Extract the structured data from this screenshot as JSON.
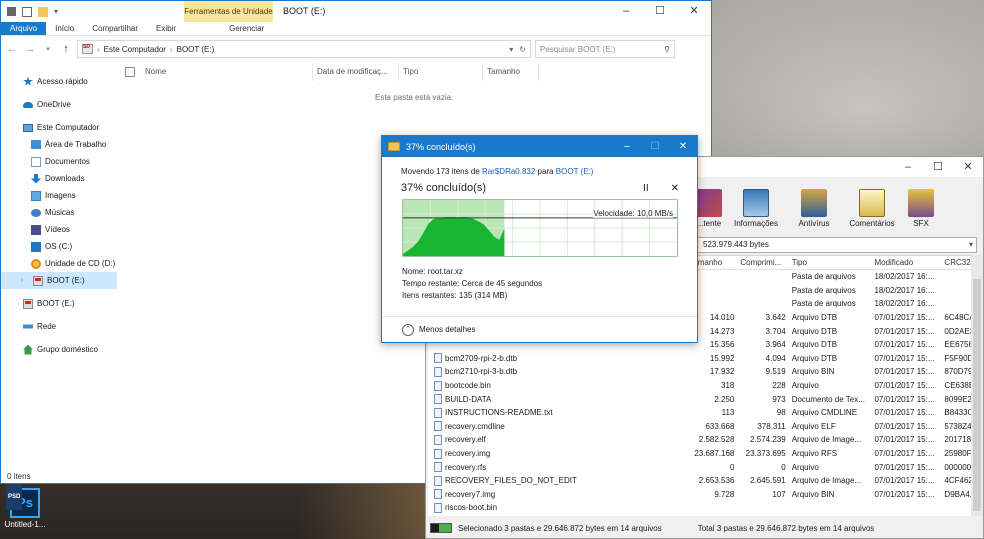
{
  "desktop": {
    "icon_label": "Untitled-1...",
    "icon_badge": "PSD",
    "icon_glyph": "Ps"
  },
  "explorer": {
    "title": "BOOT (E:)",
    "context_tab": "Ferramentas de Unidade",
    "ribbon_tabs": [
      "Arquivo",
      "Início",
      "Compartilhar",
      "Exibir",
      "Gerenciar"
    ],
    "breadcrumb": [
      "Este Computador",
      "BOOT (E:)"
    ],
    "search_placeholder": "Pesquisar BOOT (E:)",
    "columns": [
      "Nome",
      "Data de modificaç...",
      "Tipo",
      "Tamanho"
    ],
    "empty_message": "Esta pasta está vazia.",
    "status": "0 itens",
    "nav": [
      {
        "label": "Acesso rápido",
        "icon": "star-icon"
      },
      {
        "label": "OneDrive",
        "icon": "cloud-icon"
      },
      {
        "label": "Este Computador",
        "icon": "computer-icon"
      },
      {
        "label": "Área de Trabalho",
        "icon": "folder-icon"
      },
      {
        "label": "Documentos",
        "icon": "documents-icon"
      },
      {
        "label": "Downloads",
        "icon": "download-icon"
      },
      {
        "label": "Imagens",
        "icon": "images-icon"
      },
      {
        "label": "Músicas",
        "icon": "music-icon"
      },
      {
        "label": "Vídeos",
        "icon": "video-icon"
      },
      {
        "label": "OS (C:)",
        "icon": "windows-drive-icon"
      },
      {
        "label": "Unidade de CD (D:)",
        "icon": "cd-drive-icon"
      },
      {
        "label": "BOOT (E:)",
        "icon": "sd-drive-icon"
      },
      {
        "label": "BOOT (E:)",
        "icon": "sd-drive-icon"
      },
      {
        "label": "Rede",
        "icon": "network-icon"
      },
      {
        "label": "Grupo doméstico",
        "icon": "homegroup-icon"
      }
    ]
  },
  "dialog": {
    "title": "37% concluído(s)",
    "moving_prefix": "Movendo 173 itens de ",
    "source": "Rar$DRa0.832",
    "to": " para ",
    "destination": "BOOT (E:)",
    "percent_text": "37% concluído(s)",
    "pause": "II",
    "close": "✕",
    "speed": "Velocidade: 10,0 MB/s",
    "name": "Nome: root.tar.xz",
    "time_left": "Tempo restante: Cerca de 45 segundos",
    "items_left": "Itens restantes: 135 (314 MB)",
    "less_details": "Menos detalhes",
    "progress": 0.37,
    "accent": "#1979ca",
    "graph_color": "#06b025"
  },
  "rar": {
    "toolbar": [
      "...tente",
      "Informações",
      "Antivírus",
      "Comentários",
      "SFX"
    ],
    "path": "523.979.443 bytes",
    "columns": [
      "...manho",
      "Comprimi...",
      "Tipo",
      "Modificado",
      "CRC32"
    ],
    "rows": [
      {
        "name": "",
        "size": "",
        "packed": "",
        "type": "Pasta de arquivos",
        "mod": "18/02/2017 16:...",
        "crc": ""
      },
      {
        "name": "",
        "size": "",
        "packed": "",
        "type": "Pasta de arquivos",
        "mod": "18/02/2017 16:...",
        "crc": ""
      },
      {
        "name": "",
        "size": "",
        "packed": "",
        "type": "Pasta de arquivos",
        "mod": "18/02/2017 16:...",
        "crc": ""
      },
      {
        "name": "",
        "size": "14.010",
        "packed": "3.642",
        "type": "Arquivo DTB",
        "mod": "07/01/2017 15:...",
        "crc": "6C48CA..."
      },
      {
        "name": "",
        "size": "14.273",
        "packed": "3.704",
        "type": "Arquivo DTB",
        "mod": "07/01/2017 15:...",
        "crc": "0D2AE3..."
      },
      {
        "name": "",
        "size": "15.356",
        "packed": "3.964",
        "type": "Arquivo DTB",
        "mod": "07/01/2017 15:...",
        "crc": "EE6758..."
      },
      {
        "name": "bcm2709-rpi-2-b.dtb",
        "size": "15.992",
        "packed": "4.094",
        "type": "Arquivo DTB",
        "mod": "07/01/2017 15:...",
        "crc": "F5F90D..."
      },
      {
        "name": "bcm2710-rpi-3-b.dtb",
        "size": "17.932",
        "packed": "9.519",
        "type": "Arquivo BIN",
        "mod": "07/01/2017 15:...",
        "crc": "870D79..."
      },
      {
        "name": "bootcode.bin",
        "size": "318",
        "packed": "228",
        "type": "Arquivo",
        "mod": "07/01/2017 15:...",
        "crc": "CE638B..."
      },
      {
        "name": "BUILD-DATA",
        "size": "2.250",
        "packed": "973",
        "type": "Documento de Tex...",
        "mod": "07/01/2017 15:...",
        "crc": "8099E2..."
      },
      {
        "name": "INSTRUCTIONS-README.txt",
        "size": "113",
        "packed": "98",
        "type": "Arquivo CMDLINE",
        "mod": "07/01/2017 15:...",
        "crc": "B8433C..."
      },
      {
        "name": "recovery.cmdline",
        "size": "633.668",
        "packed": "378.311",
        "type": "Arquivo ELF",
        "mod": "07/01/2017 15:...",
        "crc": "5738Z4..."
      },
      {
        "name": "recovery.elf",
        "size": "2.582.528",
        "packed": "2.574.239",
        "type": "Arquivo de Image...",
        "mod": "07/01/2017 15:...",
        "crc": "201718..."
      },
      {
        "name": "recovery.img",
        "size": "23.687.168",
        "packed": "23.373.695",
        "type": "Arquivo RFS",
        "mod": "07/01/2017 15:...",
        "crc": "25980F..."
      },
      {
        "name": "recovery.rfs",
        "size": "0",
        "packed": "0",
        "type": "Arquivo",
        "mod": "07/01/2017 15:...",
        "crc": "000000..."
      },
      {
        "name": "RECOVERY_FILES_DO_NOT_EDIT",
        "size": "2.653.536",
        "packed": "2.645.591",
        "type": "Arquivo de Image...",
        "mod": "07/01/2017 15:...",
        "crc": "4CF462..."
      },
      {
        "name": "recovery7.img",
        "size": "9.728",
        "packed": "107",
        "type": "Arquivo BIN",
        "mod": "07/01/2017 15:...",
        "crc": "D9BA4..."
      },
      {
        "name": "riscos-boot.bin",
        "size": "",
        "packed": "",
        "type": "",
        "mod": "",
        "crc": ""
      }
    ],
    "status_left": "Selecionado 3 pastas e 29.646.872 bytes em 14 arquivos",
    "status_right": "Total 3 pastas e 29.646.872 bytes em 14 arquivos"
  }
}
